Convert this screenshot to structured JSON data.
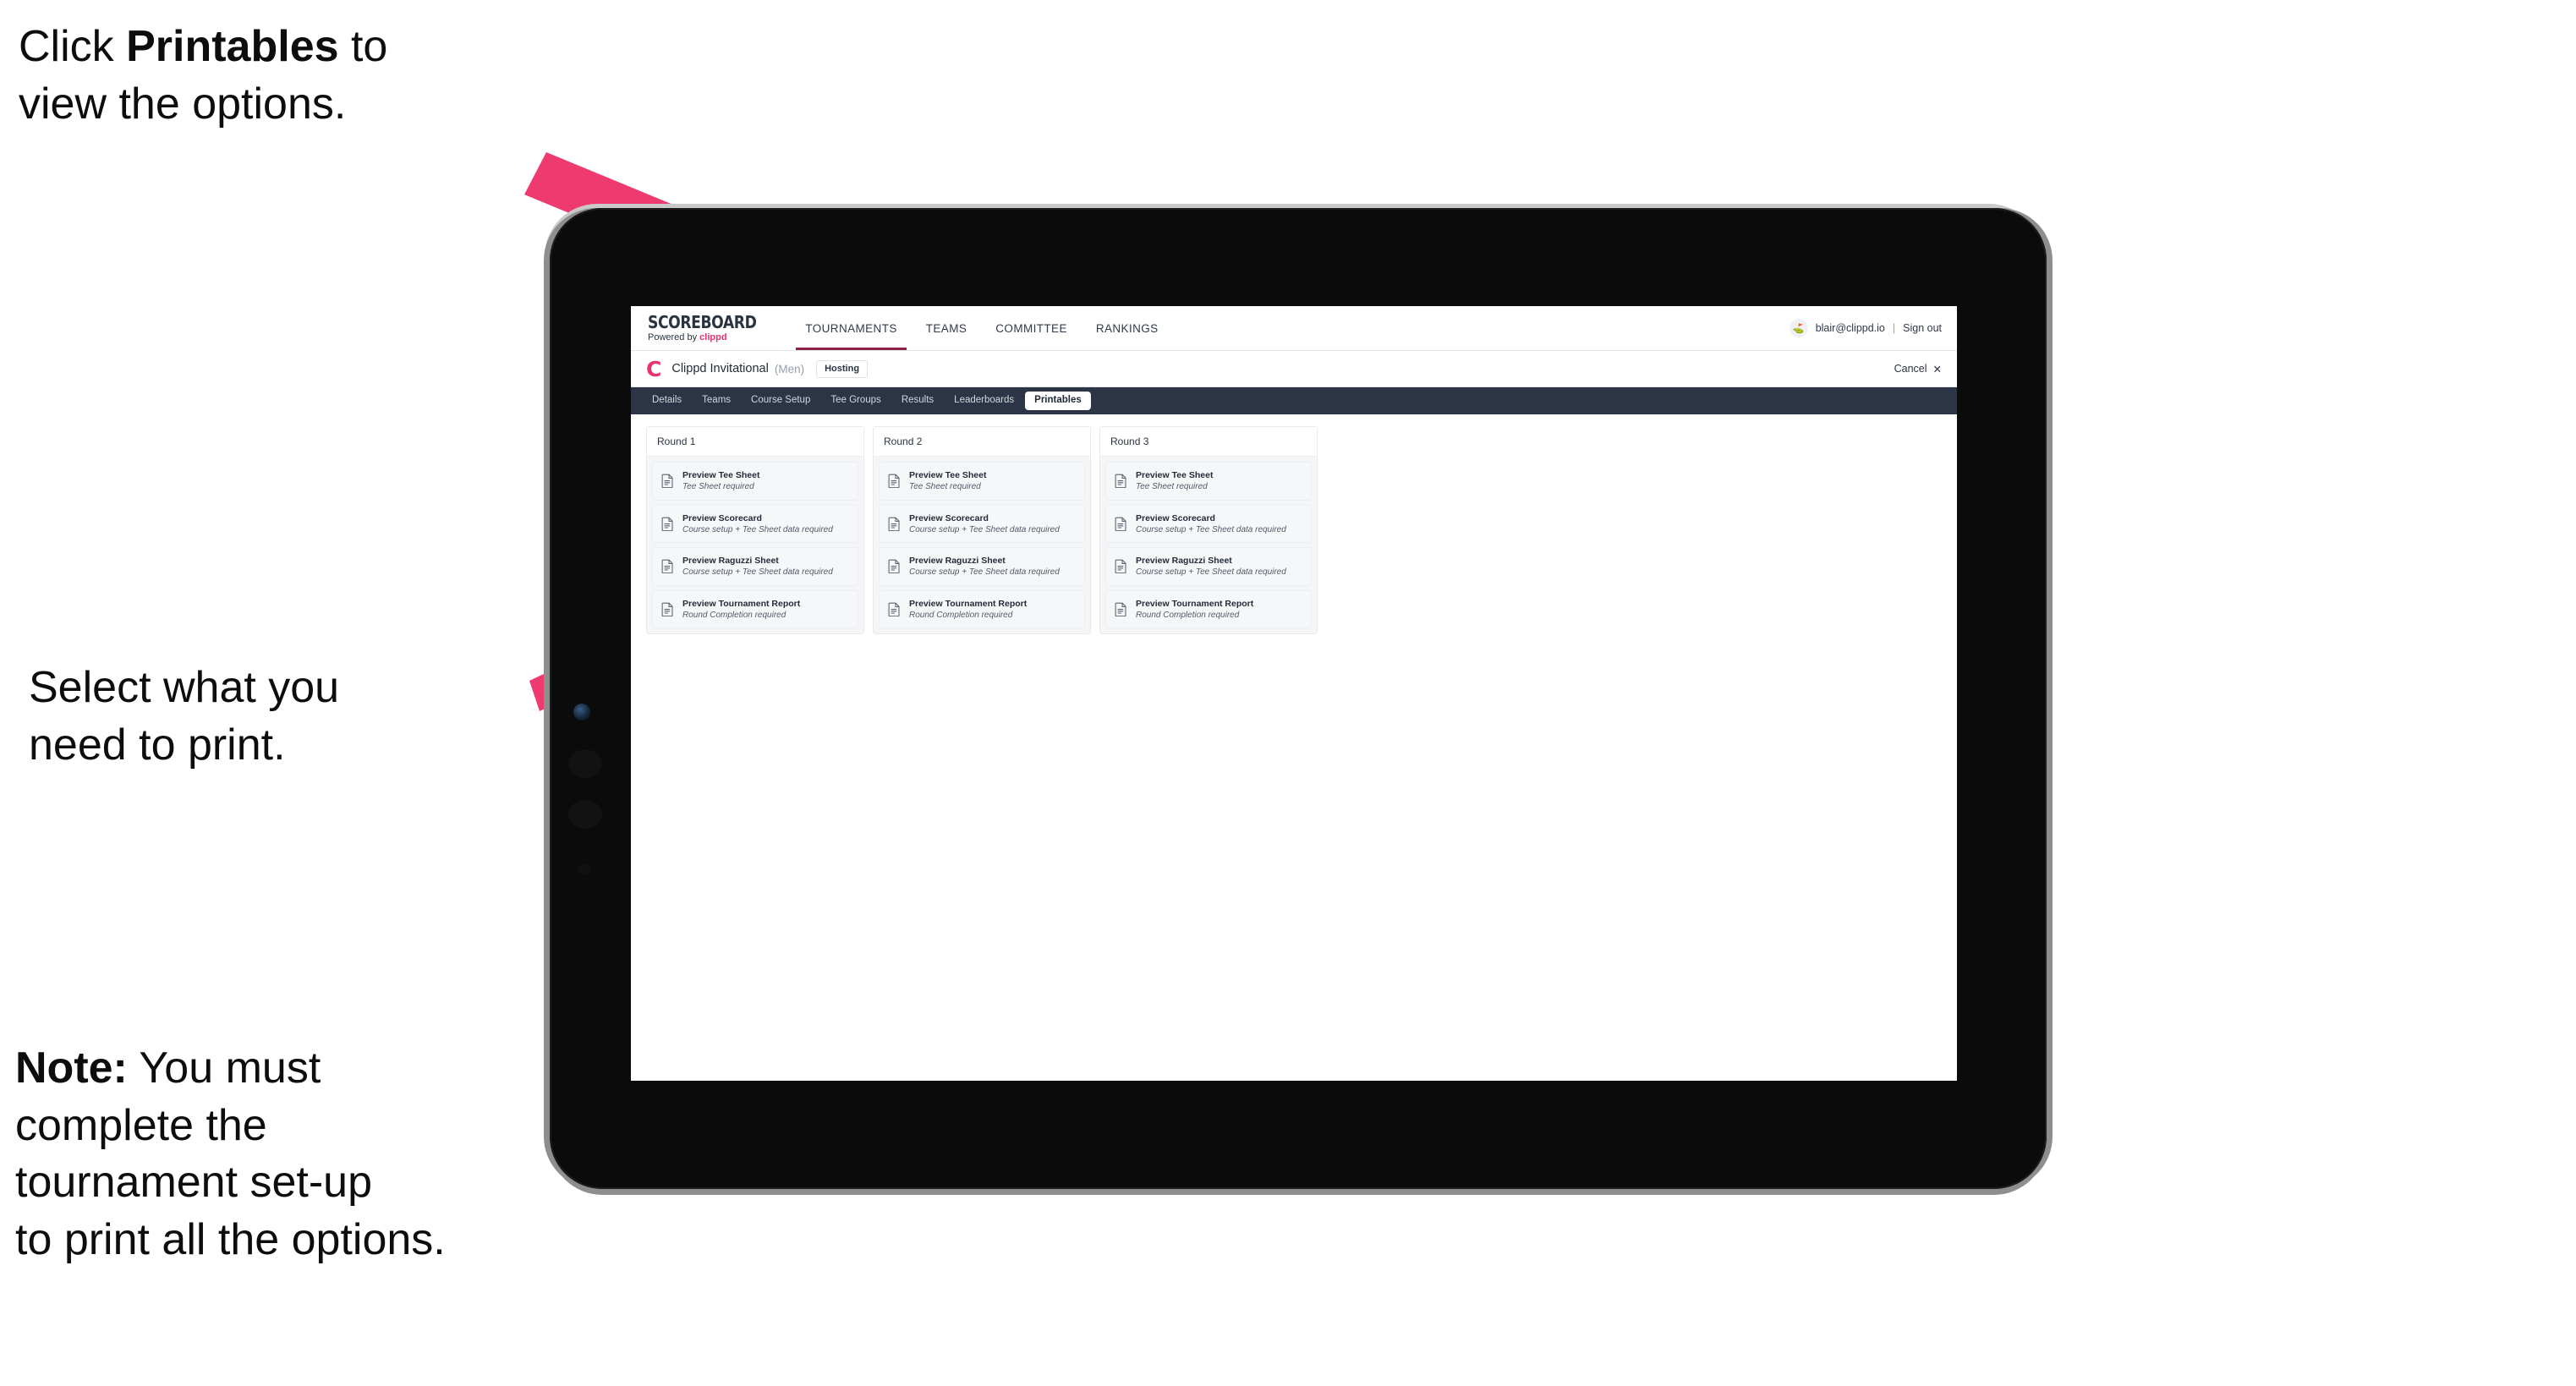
{
  "annotations": {
    "callout_1": "Click Printables to\nview the options.",
    "callout_1_plain_a": "Click ",
    "callout_1_bold": "Printables",
    "callout_1_plain_b": " to\nview the options.",
    "callout_2": "Select what you\n need to print.",
    "callout_3_bold": "Note:",
    "callout_3_rest": " You must\ncomplete the\ntournament set-up\nto print all the options.",
    "arrow_color": "#ef3a70"
  },
  "app": {
    "brand": {
      "wordmark": "SCOREBOARD",
      "powered_by_prefix": "Powered by ",
      "powered_by_brand": "clippd"
    },
    "nav": [
      {
        "label": "TOURNAMENTS",
        "active": true
      },
      {
        "label": "TEAMS",
        "active": false
      },
      {
        "label": "COMMITTEE",
        "active": false
      },
      {
        "label": "RANKINGS",
        "active": false
      }
    ],
    "user": {
      "avatar_glyph": "⛳",
      "email": "blair@clippd.io",
      "separator": "|",
      "sign_out": "Sign out"
    },
    "tournament": {
      "logo_letter": "C",
      "name": "Clippd Invitational",
      "gender": "(Men)",
      "status_badge": "Hosting",
      "cancel_label": "Cancel",
      "cancel_icon": "✕"
    },
    "tabs": [
      {
        "label": "Details",
        "active": false
      },
      {
        "label": "Teams",
        "active": false
      },
      {
        "label": "Course Setup",
        "active": false
      },
      {
        "label": "Tee Groups",
        "active": false
      },
      {
        "label": "Results",
        "active": false
      },
      {
        "label": "Leaderboards",
        "active": false
      },
      {
        "label": "Printables",
        "active": true
      }
    ],
    "rounds": [
      {
        "title": "Round 1",
        "items": [
          {
            "title": "Preview Tee Sheet",
            "sub": "Tee Sheet required"
          },
          {
            "title": "Preview Scorecard",
            "sub": "Course setup + Tee Sheet data required"
          },
          {
            "title": "Preview Raguzzi Sheet",
            "sub": "Course setup + Tee Sheet data required"
          },
          {
            "title": "Preview Tournament Report",
            "sub": "Round Completion required"
          }
        ]
      },
      {
        "title": "Round 2",
        "items": [
          {
            "title": "Preview Tee Sheet",
            "sub": "Tee Sheet required"
          },
          {
            "title": "Preview Scorecard",
            "sub": "Course setup + Tee Sheet data required"
          },
          {
            "title": "Preview Raguzzi Sheet",
            "sub": "Course setup + Tee Sheet data required"
          },
          {
            "title": "Preview Tournament Report",
            "sub": "Round Completion required"
          }
        ]
      },
      {
        "title": "Round 3",
        "items": [
          {
            "title": "Preview Tee Sheet",
            "sub": "Tee Sheet required"
          },
          {
            "title": "Preview Scorecard",
            "sub": "Course setup + Tee Sheet data required"
          },
          {
            "title": "Preview Raguzzi Sheet",
            "sub": "Course setup + Tee Sheet data required"
          },
          {
            "title": "Preview Tournament Report",
            "sub": "Round Completion required"
          }
        ]
      }
    ],
    "colors": {
      "tab_strip_bg": "#2c3546",
      "brand_pink": "#e8336e",
      "active_nav_underline": "#8f2347"
    }
  }
}
